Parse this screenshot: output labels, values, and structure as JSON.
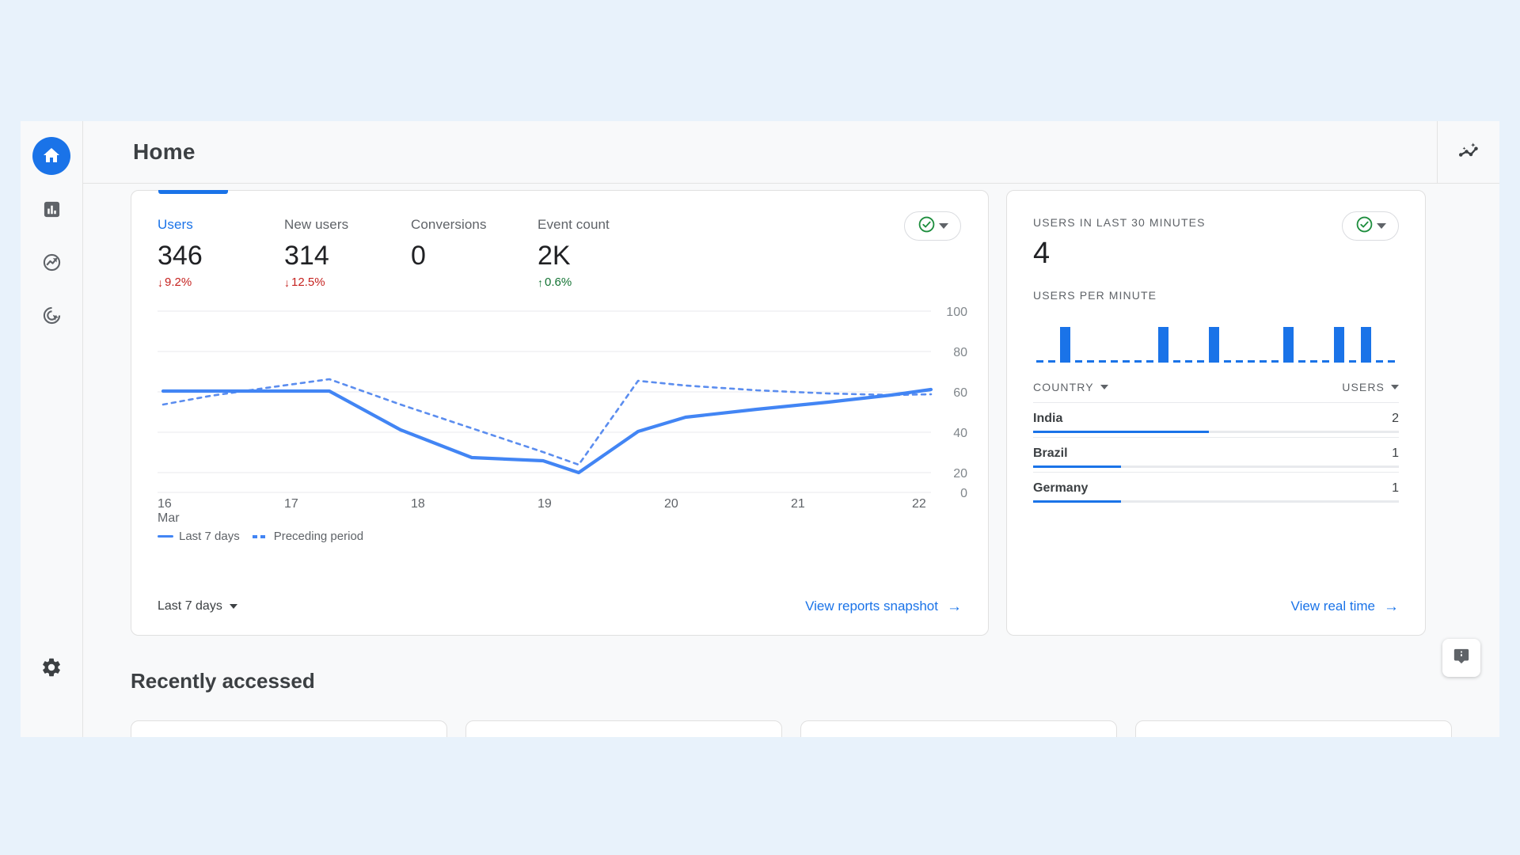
{
  "header": {
    "title": "Home",
    "insights_icon": "insights-sparkline-icon"
  },
  "sidebar": {
    "items": [
      {
        "name": "home",
        "icon": "home-icon",
        "active": true
      },
      {
        "name": "reports",
        "icon": "bar-chart-icon",
        "active": false
      },
      {
        "name": "explore",
        "icon": "explore-trend-icon",
        "active": false
      },
      {
        "name": "advertising",
        "icon": "advertising-target-icon",
        "active": false
      }
    ],
    "settings": {
      "name": "settings",
      "icon": "gear-icon"
    }
  },
  "overview_card": {
    "metrics": [
      {
        "label": "Users",
        "value": "346",
        "delta": "9.2%",
        "direction": "down",
        "selected": true
      },
      {
        "label": "New users",
        "value": "314",
        "delta": "12.5%",
        "direction": "down",
        "selected": false
      },
      {
        "label": "Conversions",
        "value": "0",
        "delta": "",
        "direction": "none",
        "selected": false
      },
      {
        "label": "Event count",
        "value": "2K",
        "delta": "0.6%",
        "direction": "up",
        "selected": false
      }
    ],
    "status_chip": {
      "icon": "check-circle-icon",
      "dropdown_icon": "chevron-down-icon"
    },
    "date_range": "Last 7 days",
    "link_label": "View reports snapshot",
    "link_icon": "arrow-right-icon"
  },
  "realtime_card": {
    "users_caption": "USERS IN LAST 30 MINUTES",
    "users_count": "4",
    "per_minute_caption": "USERS PER MINUTE",
    "status_chip": {
      "icon": "check-circle-icon",
      "dropdown_icon": "chevron-down-icon"
    },
    "table": {
      "columns": [
        "COUNTRY",
        "USERS"
      ],
      "rows": [
        {
          "country": "India",
          "users": "2",
          "bar_pct": 48
        },
        {
          "country": "Brazil",
          "users": "1",
          "bar_pct": 24
        },
        {
          "country": "Germany",
          "users": "1",
          "bar_pct": 24
        }
      ]
    },
    "link_label": "View real time",
    "link_icon": "arrow-right-icon"
  },
  "recently_accessed": {
    "title": "Recently accessed"
  },
  "feedback": {
    "icon": "feedback-icon"
  },
  "colors": {
    "accent_blue": "#1a73e8",
    "chart_blue": "#4285f4",
    "down_red": "#c5221f",
    "up_green": "#137333",
    "check_green": "#1e8e3e",
    "page_bg": "#e8f2fb",
    "surface": "#ffffff",
    "toolbar_bg": "#f8f9fa"
  },
  "chart_data": [
    {
      "type": "line",
      "title": "Users over time",
      "xlabel": "",
      "ylabel": "",
      "x": [
        "16",
        "17",
        "18",
        "19",
        "20",
        "21",
        "22"
      ],
      "x_unit_label": "Mar",
      "ylim": [
        0,
        100
      ],
      "yticks": [
        0,
        20,
        40,
        60,
        80,
        100
      ],
      "grid": true,
      "legend_position": "bottom-left",
      "series": [
        {
          "name": "Last 7 days",
          "style": "solid",
          "values": [
            66,
            66,
            66,
            33,
            31,
            26,
            52,
            60,
            66
          ]
        },
        {
          "name": "Preceding period",
          "style": "dashed",
          "values": [
            60,
            64,
            70,
            55,
            44,
            30,
            73,
            68,
            67
          ]
        }
      ]
    },
    {
      "type": "bar",
      "title": "Users per minute",
      "xlabel": "",
      "ylabel": "",
      "categories": [
        "30",
        "29",
        "28",
        "27",
        "26",
        "25",
        "24",
        "23",
        "22",
        "21",
        "20",
        "19",
        "18",
        "17",
        "16",
        "15",
        "14",
        "13",
        "12",
        "11",
        "10",
        "9",
        "8",
        "7",
        "6",
        "5",
        "4",
        "3",
        "2",
        "1"
      ],
      "values": [
        0,
        0,
        1,
        0,
        0,
        0,
        0,
        0,
        0,
        0,
        1,
        0,
        0,
        0,
        1,
        0,
        0,
        0,
        0,
        0,
        1,
        0,
        0,
        1,
        0,
        1,
        0,
        0,
        0,
        0
      ],
      "ylim": [
        0,
        1
      ]
    },
    {
      "type": "bar",
      "title": "Users by country",
      "categories": [
        "India",
        "Brazil",
        "Germany"
      ],
      "values": [
        2,
        1,
        1
      ],
      "xlabel": "COUNTRY",
      "ylabel": "USERS",
      "ylim": [
        0,
        2
      ]
    }
  ]
}
